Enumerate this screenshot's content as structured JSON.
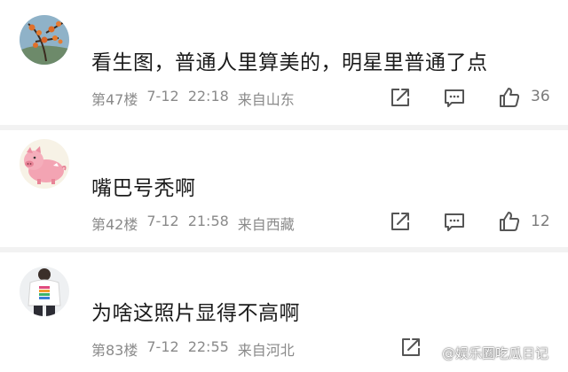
{
  "comments": [
    {
      "text": "看生图，普通人里算美的，明星里普通了点",
      "floor": "第47楼",
      "date": "7-12",
      "time": "22:18",
      "location": "来自山东",
      "likes": "36"
    },
    {
      "text": "嘴巴号秃啊",
      "floor": "第42楼",
      "date": "7-12",
      "time": "21:58",
      "location": "来自西藏",
      "likes": "12"
    },
    {
      "text": "为啥这照片显得不高啊",
      "floor": "第83楼",
      "date": "7-12",
      "time": "22:55",
      "location": "来自河北",
      "likes": ""
    }
  ],
  "watermark": {
    "text": "@娱乐圈吃瓜日记"
  },
  "icons": {
    "share": "share-icon",
    "reply": "comment-icon",
    "like": "thumbs-up-icon",
    "camera": "camera-icon"
  },
  "colors": {
    "meta_text": "#8a8a8a",
    "icon_stroke": "#555555",
    "divider": "#f2f2f2"
  }
}
